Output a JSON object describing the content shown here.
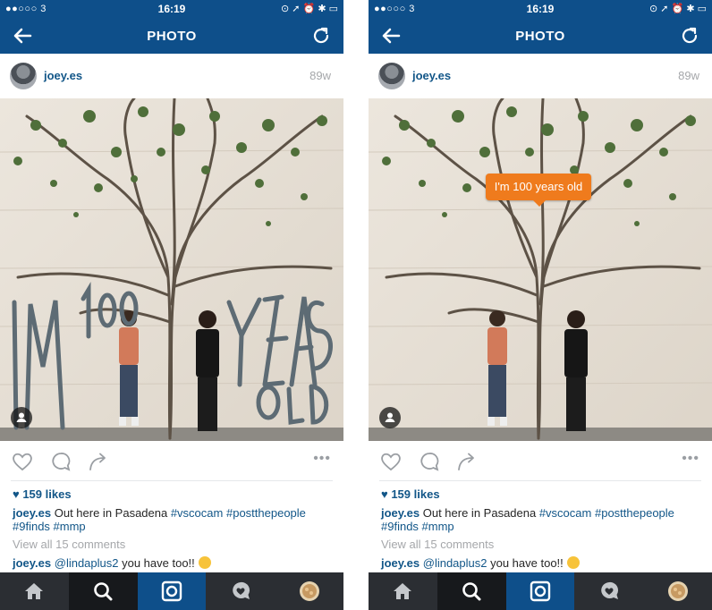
{
  "status_bar": {
    "carrier": "●●○○○ 3",
    "time": "16:19",
    "system": "⊙ ➚ ⏰ ✱ ▭"
  },
  "nav": {
    "title": "PHOTO",
    "back_icon": "arrow-left-icon",
    "refresh_icon": "refresh-icon"
  },
  "post": {
    "username": "joey.es",
    "time_ago": "89w",
    "photo_text_overlay": "I'M 100 YEARS OLD",
    "tag_bubble": "I'm 100 years old",
    "likes": "♥ 159 likes",
    "caption_user": "joey.es",
    "caption_text": " Out here in Pasadena ",
    "caption_tags": [
      "#vscocam",
      "#postthepeople",
      "#9finds",
      "#mmp"
    ],
    "view_all": "View all 15 comments",
    "comment_user": "joey.es",
    "comment_mention": "@lindaplus2",
    "comment_text": " you have too!!"
  },
  "tabbar": [
    "home-icon",
    "search-icon",
    "camera-icon",
    "activity-icon",
    "profile-icon"
  ],
  "colors": {
    "brand_blue": "#0e4f8a",
    "link_blue": "#125688",
    "tag_orange": "#ef7b1d",
    "tabbar": "#2b2e33"
  }
}
